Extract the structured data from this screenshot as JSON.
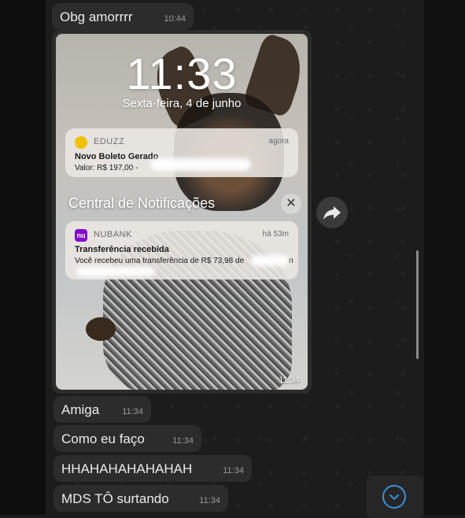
{
  "messages_top": {
    "text": "Obg amorrrr",
    "time": "10:44"
  },
  "image_message": {
    "lock_screen": {
      "time": "11:33",
      "date": "Sexta-feira, 4 de junho"
    },
    "notifications": [
      {
        "app_name": "EDUZZ",
        "when": "agora",
        "title": "Novo Boleto Gerado",
        "body": "Valor: R$ 197,00 -",
        "icon_color": "#f2c200"
      },
      {
        "app_name": "NUBANK",
        "when": "há 53m",
        "title": "Transferência recebida",
        "body": "Você recebeu uma transferência de R$ 73,98 de",
        "body_tail": "n",
        "icon_color": "#820ad1",
        "icon_label": "nu"
      }
    ],
    "notification_center": {
      "label": "Central de Notificações",
      "close_glyph": "✕"
    },
    "timestamp": "11:34"
  },
  "messages_bottom": [
    {
      "text": "Amiga",
      "time": "11:34"
    },
    {
      "text": "Como eu faço",
      "time": "11:34"
    },
    {
      "text": "HHAHAHAHAHAHAH",
      "time": "11:34"
    },
    {
      "text": "MDS TÔ surtando",
      "time": "11:34"
    }
  ],
  "colors": {
    "background": "#1b1b1b",
    "bubble": "#2c2c2c",
    "accent_blue": "#3a8fd6"
  },
  "icons": {
    "forward": "forward-arrow-icon",
    "scroll_down": "chevron-down-icon"
  }
}
